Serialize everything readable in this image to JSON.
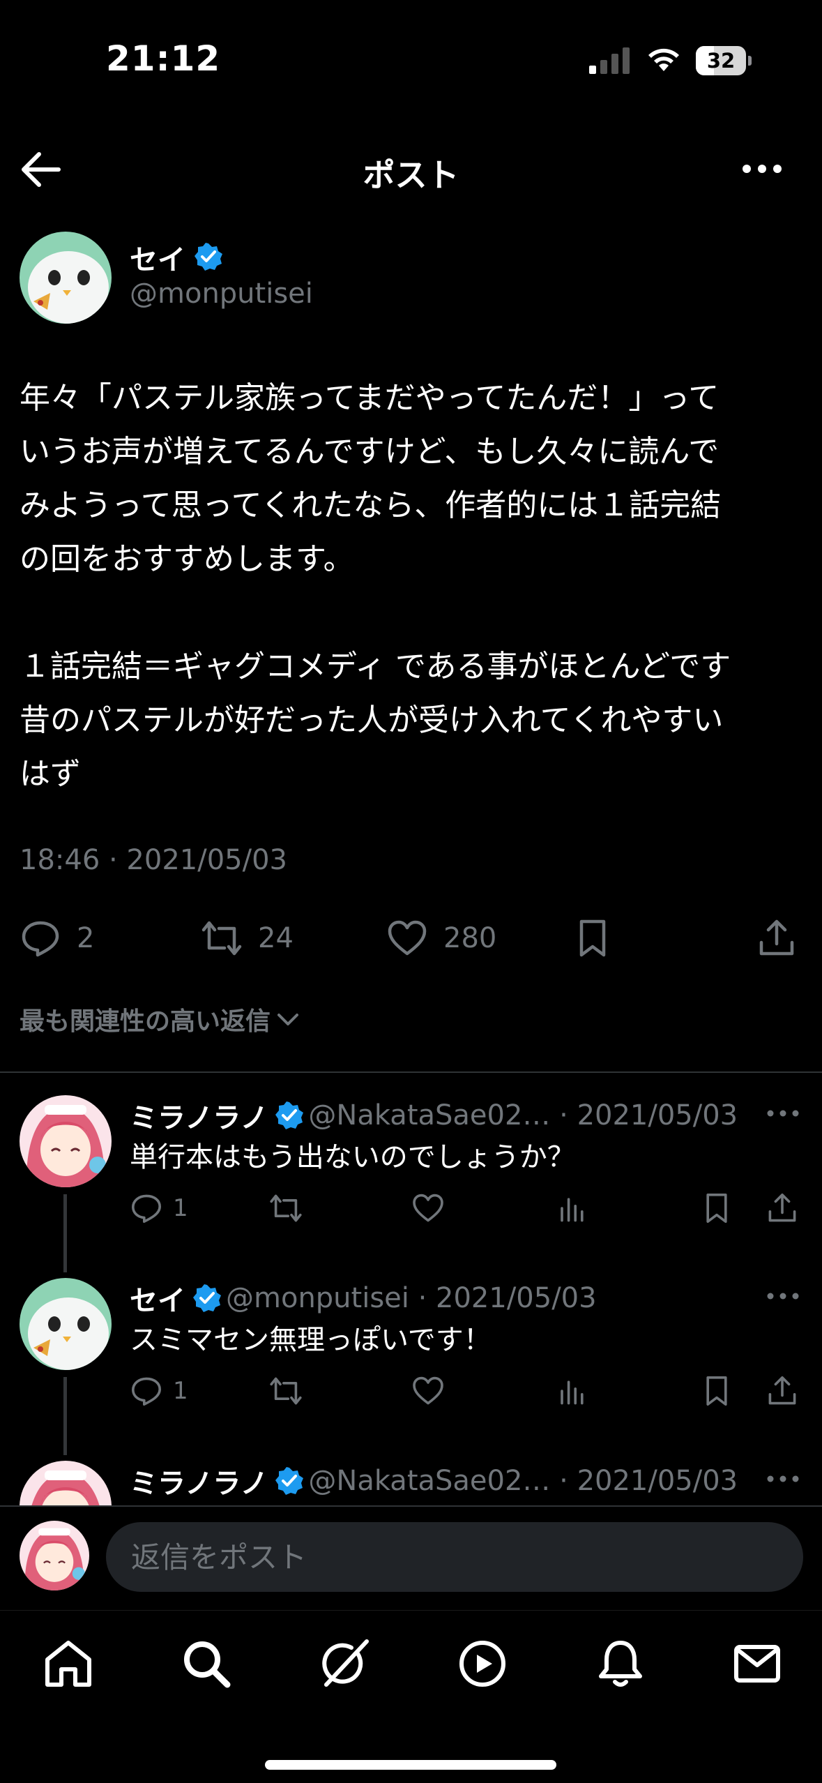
{
  "status_bar": {
    "time": "21:12",
    "battery": "32"
  },
  "header": {
    "title": "ポスト"
  },
  "post": {
    "author_name": "セイ",
    "author_handle": "@monputisei",
    "text": "年々「パステル家族ってまだやってたんだ！」って\nいうお声が増えてるんですけど、もし久々に読んで\nみようって思ってくれたなら、作者的には１話完結\nの回をおすすめします。\n\n１話完結＝ギャグコメディ である事がほとんどです\n昔のパステルが好だった人が受け入れてくれやすい\nはず",
    "timestamp": "18:46 · 2021/05/03",
    "replies_count": "2",
    "reposts_count": "24",
    "likes_count": "280"
  },
  "sort_label": "最も関連性の高い返信",
  "replies": [
    {
      "name": "ミラノラノ",
      "handle": "@NakataSae02… · 2021/05/03",
      "text": "単行本はもう出ないのでしょうか？",
      "reply_count": "1"
    },
    {
      "name": "セイ",
      "handle": "@monputisei · 2021/05/03",
      "text": "スミマセン無理っぽいです！",
      "reply_count": "1"
    },
    {
      "name": "ミラノラノ",
      "handle": "@NakataSae02… · 2021/05/03"
    }
  ],
  "composer": {
    "placeholder": "返信をポスト"
  },
  "colors": {
    "background": "#000000",
    "text": "#e7e9ea",
    "secondary": "#71767b",
    "verified": "#1d9bf0"
  },
  "tabs": [
    "home-icon",
    "search-icon",
    "grok-icon",
    "video-icon",
    "notifications-icon",
    "messages-icon"
  ]
}
